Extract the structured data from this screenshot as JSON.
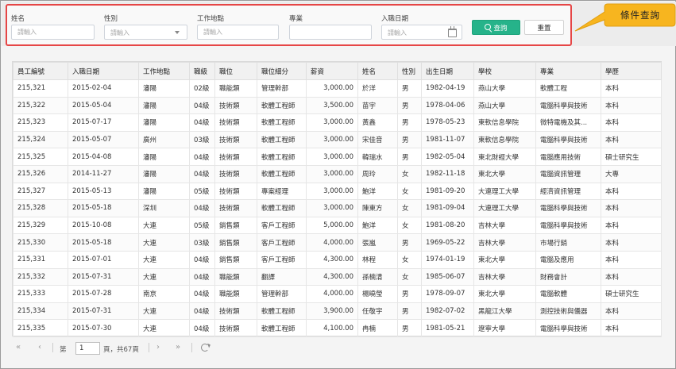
{
  "filters": {
    "name": {
      "label": "姓名",
      "placeholder": "請輸入"
    },
    "gender": {
      "label": "性別",
      "placeholder": "請輸入"
    },
    "location": {
      "label": "工作地點",
      "placeholder": "請輸入"
    },
    "major": {
      "label": "專業",
      "value": ""
    },
    "hire_date": {
      "label": "入職日期",
      "placeholder": "請輸入"
    },
    "query_label": "查詢",
    "reset_label": "重置"
  },
  "callout": {
    "text": "條件查詢"
  },
  "colors": {
    "accent": "#26b38a",
    "highlight_border": "#e64646",
    "callout_fill": "#f7b51f"
  },
  "table": {
    "columns": [
      "員工編號",
      "入職日期",
      "工作地點",
      "職級",
      "職位",
      "職位細分",
      "薪資",
      "姓名",
      "性別",
      "出生日期",
      "學校",
      "專業",
      "學歷"
    ],
    "rows": [
      [
        "215,321",
        "2015-02-04",
        "瀋陽",
        "02級",
        "職能類",
        "管理幹部",
        "3,000.00",
        "於洋",
        "男",
        "1982-04-19",
        "燕山大學",
        "軟體工程",
        "本科"
      ],
      [
        "215,322",
        "2015-05-04",
        "瀋陽",
        "04級",
        "技術類",
        "軟體工程師",
        "3,500.00",
        "苗宇",
        "男",
        "1978-04-06",
        "燕山大學",
        "電腦科學與技術",
        "本科"
      ],
      [
        "215,323",
        "2015-07-17",
        "瀋陽",
        "04級",
        "技術類",
        "軟體工程師",
        "3,000.00",
        "黃鑫",
        "男",
        "1978-05-23",
        "東軟信息學院",
        "微特電機及其...",
        "本科"
      ],
      [
        "215,324",
        "2015-05-07",
        "廣州",
        "03級",
        "技術類",
        "軟體工程師",
        "3,000.00",
        "宋佳音",
        "男",
        "1981-11-07",
        "東軟信息學院",
        "電腦科學與技術",
        "本科"
      ],
      [
        "215,325",
        "2015-04-08",
        "瀋陽",
        "04級",
        "技術類",
        "軟體工程師",
        "3,000.00",
        "韓瑞水",
        "男",
        "1982-05-04",
        "東北財經大學",
        "電腦應用技術",
        "碩士研究生"
      ],
      [
        "215,326",
        "2014-11-27",
        "瀋陽",
        "04級",
        "技術類",
        "軟體工程師",
        "3,000.00",
        "周玲",
        "女",
        "1982-11-18",
        "東北大學",
        "電腦資訊管理",
        "大專"
      ],
      [
        "215,327",
        "2015-05-13",
        "瀋陽",
        "05級",
        "技術類",
        "專案經理",
        "3,000.00",
        "鮑洋",
        "女",
        "1981-09-20",
        "大連理工大學",
        "經濟資訊管理",
        "本科"
      ],
      [
        "215,328",
        "2015-05-18",
        "深圳",
        "04級",
        "技術類",
        "軟體工程師",
        "3,000.00",
        "陳東方",
        "女",
        "1981-09-04",
        "大連理工大學",
        "電腦科學與技術",
        "本科"
      ],
      [
        "215,329",
        "2015-10-08",
        "大連",
        "05級",
        "銷售類",
        "客戶工程師",
        "5,000.00",
        "鮑洋",
        "女",
        "1981-08-20",
        "吉林大學",
        "電腦科學與技術",
        "本科"
      ],
      [
        "215,330",
        "2015-05-18",
        "大連",
        "03級",
        "銷售類",
        "客戶工程師",
        "4,000.00",
        "張嵐",
        "男",
        "1969-05-22",
        "吉林大學",
        "市場行銷",
        "本科"
      ],
      [
        "215,331",
        "2015-07-01",
        "大連",
        "04級",
        "銷售類",
        "客戶工程師",
        "4,300.00",
        "林程",
        "女",
        "1974-01-19",
        "東北大學",
        "電腦及應用",
        "本科"
      ],
      [
        "215,332",
        "2015-07-31",
        "大連",
        "04級",
        "職能類",
        "翻譯",
        "4,300.00",
        "孫楠清",
        "女",
        "1985-06-07",
        "吉林大學",
        "財務會計",
        "本科"
      ],
      [
        "215,333",
        "2015-07-28",
        "南京",
        "04級",
        "職能類",
        "管理幹部",
        "4,000.00",
        "楊曉瑩",
        "男",
        "1978-09-07",
        "東北大學",
        "電腦軟體",
        "碩士研究生"
      ],
      [
        "215,334",
        "2015-07-31",
        "大連",
        "04級",
        "技術類",
        "軟體工程師",
        "3,900.00",
        "任敬宇",
        "男",
        "1982-07-02",
        "黑龍江大學",
        "測控技術與儀器",
        "本科"
      ],
      [
        "215,335",
        "2015-07-30",
        "大連",
        "04級",
        "技術類",
        "軟體工程師",
        "4,100.00",
        "冉楠",
        "男",
        "1981-05-21",
        "遼寧大學",
        "電腦科學與技術",
        "本科"
      ]
    ]
  },
  "pager": {
    "first": "«",
    "prev": "‹",
    "page_prefix": "第",
    "page_value": "1",
    "page_suffix": "頁，共67頁",
    "next": "›",
    "last": "»"
  }
}
